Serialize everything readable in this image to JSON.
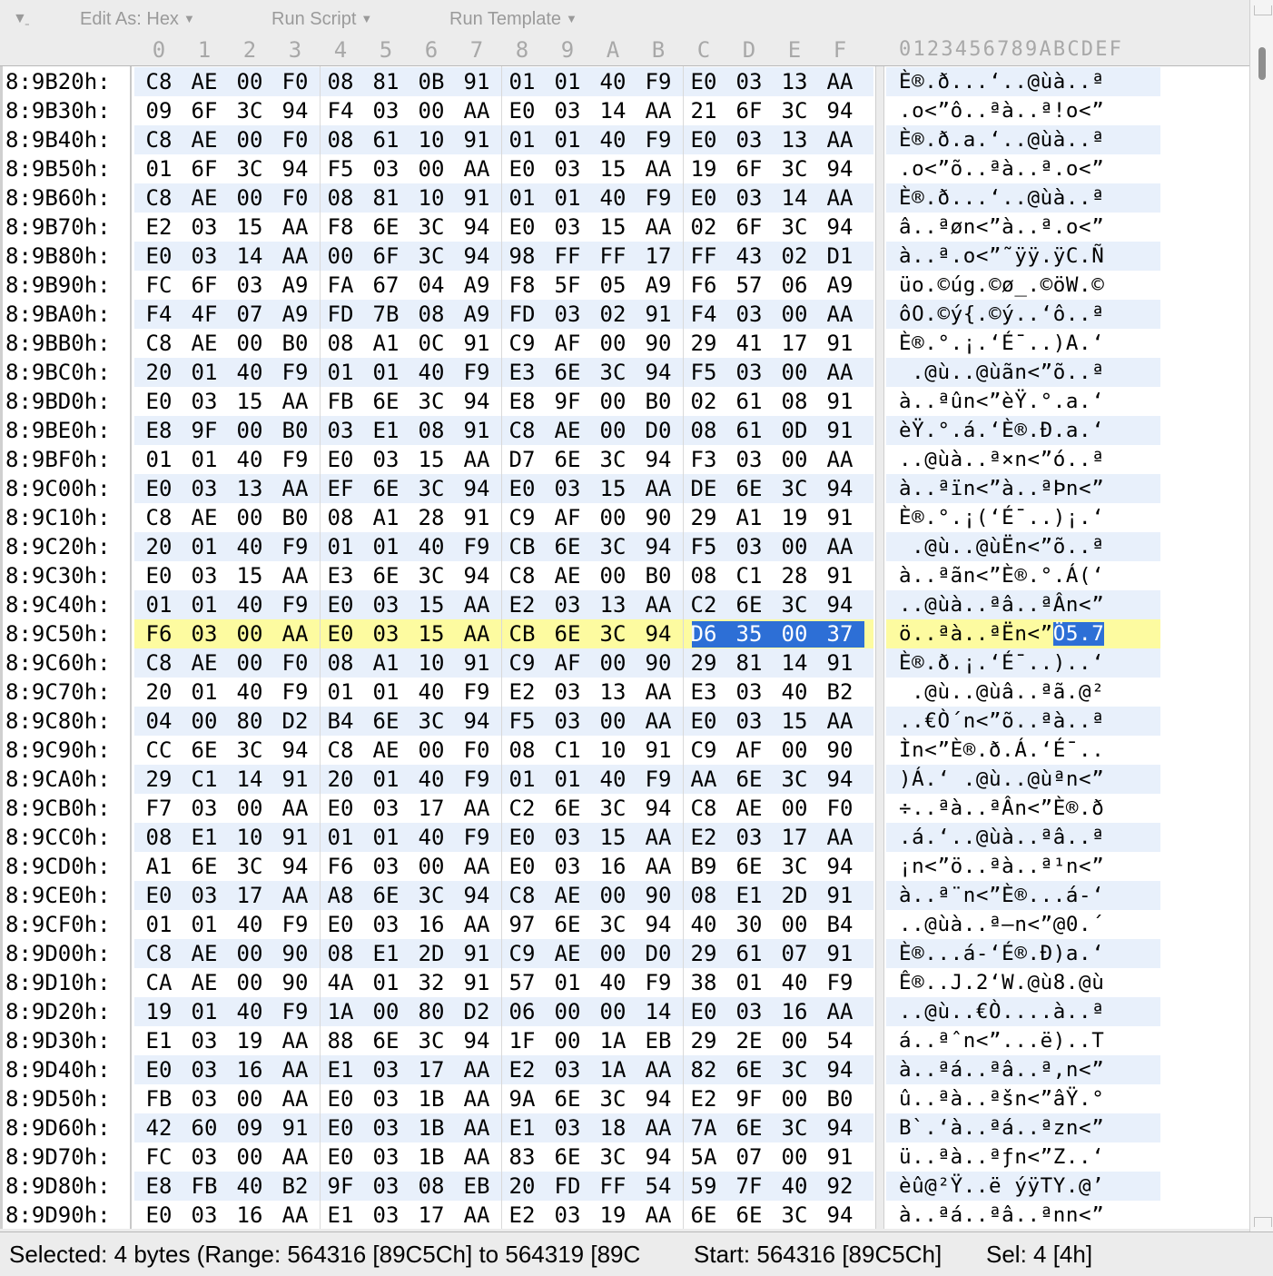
{
  "toolbar": {
    "collapse_icon": "collapse-icon",
    "edit_as": "Edit As: Hex",
    "run_script": "Run Script",
    "run_template": "Run Template",
    "dropdown_icon": "chevron-down-icon"
  },
  "header": {
    "hex_columns": [
      "0",
      "1",
      "2",
      "3",
      "4",
      "5",
      "6",
      "7",
      "8",
      "9",
      "A",
      "B",
      "C",
      "D",
      "E",
      "F"
    ],
    "ascii_header": "0123456789ABCDEF"
  },
  "rows": [
    {
      "addr": "8:9B20h:",
      "bytes": [
        "C8",
        "AE",
        "00",
        "F0",
        "08",
        "81",
        "0B",
        "91",
        "01",
        "01",
        "40",
        "F9",
        "E0",
        "03",
        "13",
        "AA"
      ],
      "ascii": "È®.ð...‘..@ùà..ª"
    },
    {
      "addr": "8:9B30h:",
      "bytes": [
        "09",
        "6F",
        "3C",
        "94",
        "F4",
        "03",
        "00",
        "AA",
        "E0",
        "03",
        "14",
        "AA",
        "21",
        "6F",
        "3C",
        "94"
      ],
      "ascii": ".o<”ô..ªà..ª!o<”"
    },
    {
      "addr": "8:9B40h:",
      "bytes": [
        "C8",
        "AE",
        "00",
        "F0",
        "08",
        "61",
        "10",
        "91",
        "01",
        "01",
        "40",
        "F9",
        "E0",
        "03",
        "13",
        "AA"
      ],
      "ascii": "È®.ð.a.‘..@ùà..ª"
    },
    {
      "addr": "8:9B50h:",
      "bytes": [
        "01",
        "6F",
        "3C",
        "94",
        "F5",
        "03",
        "00",
        "AA",
        "E0",
        "03",
        "15",
        "AA",
        "19",
        "6F",
        "3C",
        "94"
      ],
      "ascii": ".o<”õ..ªà..ª.o<”"
    },
    {
      "addr": "8:9B60h:",
      "bytes": [
        "C8",
        "AE",
        "00",
        "F0",
        "08",
        "81",
        "10",
        "91",
        "01",
        "01",
        "40",
        "F9",
        "E0",
        "03",
        "14",
        "AA"
      ],
      "ascii": "È®.ð...‘..@ùà..ª"
    },
    {
      "addr": "8:9B70h:",
      "bytes": [
        "E2",
        "03",
        "15",
        "AA",
        "F8",
        "6E",
        "3C",
        "94",
        "E0",
        "03",
        "15",
        "AA",
        "02",
        "6F",
        "3C",
        "94"
      ],
      "ascii": "â..ªøn<”à..ª.o<”"
    },
    {
      "addr": "8:9B80h:",
      "bytes": [
        "E0",
        "03",
        "14",
        "AA",
        "00",
        "6F",
        "3C",
        "94",
        "98",
        "FF",
        "FF",
        "17",
        "FF",
        "43",
        "02",
        "D1"
      ],
      "ascii": "à..ª.o<”˜ÿÿ.ÿC.Ñ"
    },
    {
      "addr": "8:9B90h:",
      "bytes": [
        "FC",
        "6F",
        "03",
        "A9",
        "FA",
        "67",
        "04",
        "A9",
        "F8",
        "5F",
        "05",
        "A9",
        "F6",
        "57",
        "06",
        "A9"
      ],
      "ascii": "üo.©úg.©ø_.©öW.©"
    },
    {
      "addr": "8:9BA0h:",
      "bytes": [
        "F4",
        "4F",
        "07",
        "A9",
        "FD",
        "7B",
        "08",
        "A9",
        "FD",
        "03",
        "02",
        "91",
        "F4",
        "03",
        "00",
        "AA"
      ],
      "ascii": "ôO.©ý{.©ý..‘ô..ª"
    },
    {
      "addr": "8:9BB0h:",
      "bytes": [
        "C8",
        "AE",
        "00",
        "B0",
        "08",
        "A1",
        "0C",
        "91",
        "C9",
        "AF",
        "00",
        "90",
        "29",
        "41",
        "17",
        "91"
      ],
      "ascii": "È®.°.¡.‘É¯..)A.‘"
    },
    {
      "addr": "8:9BC0h:",
      "bytes": [
        "20",
        "01",
        "40",
        "F9",
        "01",
        "01",
        "40",
        "F9",
        "E3",
        "6E",
        "3C",
        "94",
        "F5",
        "03",
        "00",
        "AA"
      ],
      "ascii": " .@ù..@ùãn<”õ..ª"
    },
    {
      "addr": "8:9BD0h:",
      "bytes": [
        "E0",
        "03",
        "15",
        "AA",
        "FB",
        "6E",
        "3C",
        "94",
        "E8",
        "9F",
        "00",
        "B0",
        "02",
        "61",
        "08",
        "91"
      ],
      "ascii": "à..ªûn<”èŸ.°.a.‘"
    },
    {
      "addr": "8:9BE0h:",
      "bytes": [
        "E8",
        "9F",
        "00",
        "B0",
        "03",
        "E1",
        "08",
        "91",
        "C8",
        "AE",
        "00",
        "D0",
        "08",
        "61",
        "0D",
        "91"
      ],
      "ascii": "èŸ.°.á.‘È®.Ð.a.‘"
    },
    {
      "addr": "8:9BF0h:",
      "bytes": [
        "01",
        "01",
        "40",
        "F9",
        "E0",
        "03",
        "15",
        "AA",
        "D7",
        "6E",
        "3C",
        "94",
        "F3",
        "03",
        "00",
        "AA"
      ],
      "ascii": "..@ùà..ª×n<”ó..ª"
    },
    {
      "addr": "8:9C00h:",
      "bytes": [
        "E0",
        "03",
        "13",
        "AA",
        "EF",
        "6E",
        "3C",
        "94",
        "E0",
        "03",
        "15",
        "AA",
        "DE",
        "6E",
        "3C",
        "94"
      ],
      "ascii": "à..ªïn<”à..ªÞn<”"
    },
    {
      "addr": "8:9C10h:",
      "bytes": [
        "C8",
        "AE",
        "00",
        "B0",
        "08",
        "A1",
        "28",
        "91",
        "C9",
        "AF",
        "00",
        "90",
        "29",
        "A1",
        "19",
        "91"
      ],
      "ascii": "È®.°.¡(‘É¯..)¡.‘"
    },
    {
      "addr": "8:9C20h:",
      "bytes": [
        "20",
        "01",
        "40",
        "F9",
        "01",
        "01",
        "40",
        "F9",
        "CB",
        "6E",
        "3C",
        "94",
        "F5",
        "03",
        "00",
        "AA"
      ],
      "ascii": " .@ù..@ùËn<”õ..ª"
    },
    {
      "addr": "8:9C30h:",
      "bytes": [
        "E0",
        "03",
        "15",
        "AA",
        "E3",
        "6E",
        "3C",
        "94",
        "C8",
        "AE",
        "00",
        "B0",
        "08",
        "C1",
        "28",
        "91"
      ],
      "ascii": "à..ªãn<”È®.°.Á(‘"
    },
    {
      "addr": "8:9C40h:",
      "bytes": [
        "01",
        "01",
        "40",
        "F9",
        "E0",
        "03",
        "15",
        "AA",
        "E2",
        "03",
        "13",
        "AA",
        "C2",
        "6E",
        "3C",
        "94"
      ],
      "ascii": "..@ùà..ªâ..ªÂn<”"
    },
    {
      "addr": "8:9C50h:",
      "bytes": [
        "F6",
        "03",
        "00",
        "AA",
        "E0",
        "03",
        "15",
        "AA",
        "CB",
        "6E",
        "3C",
        "94",
        "D6",
        "35",
        "00",
        "37"
      ],
      "ascii": "ö..ªà..ªËn<”Ö5.7",
      "selected": true
    },
    {
      "addr": "8:9C60h:",
      "bytes": [
        "C8",
        "AE",
        "00",
        "F0",
        "08",
        "A1",
        "10",
        "91",
        "C9",
        "AF",
        "00",
        "90",
        "29",
        "81",
        "14",
        "91"
      ],
      "ascii": "È®.ð.¡.‘É¯..)..‘"
    },
    {
      "addr": "8:9C70h:",
      "bytes": [
        "20",
        "01",
        "40",
        "F9",
        "01",
        "01",
        "40",
        "F9",
        "E2",
        "03",
        "13",
        "AA",
        "E3",
        "03",
        "40",
        "B2"
      ],
      "ascii": " .@ù..@ùâ..ªã.@²"
    },
    {
      "addr": "8:9C80h:",
      "bytes": [
        "04",
        "00",
        "80",
        "D2",
        "B4",
        "6E",
        "3C",
        "94",
        "F5",
        "03",
        "00",
        "AA",
        "E0",
        "03",
        "15",
        "AA"
      ],
      "ascii": "..€Ò´n<”õ..ªà..ª"
    },
    {
      "addr": "8:9C90h:",
      "bytes": [
        "CC",
        "6E",
        "3C",
        "94",
        "C8",
        "AE",
        "00",
        "F0",
        "08",
        "C1",
        "10",
        "91",
        "C9",
        "AF",
        "00",
        "90"
      ],
      "ascii": "Ìn<”È®.ð.Á.‘É¯.."
    },
    {
      "addr": "8:9CA0h:",
      "bytes": [
        "29",
        "C1",
        "14",
        "91",
        "20",
        "01",
        "40",
        "F9",
        "01",
        "01",
        "40",
        "F9",
        "AA",
        "6E",
        "3C",
        "94"
      ],
      "ascii": ")Á.‘ .@ù..@ùªn<”"
    },
    {
      "addr": "8:9CB0h:",
      "bytes": [
        "F7",
        "03",
        "00",
        "AA",
        "E0",
        "03",
        "17",
        "AA",
        "C2",
        "6E",
        "3C",
        "94",
        "C8",
        "AE",
        "00",
        "F0"
      ],
      "ascii": "÷..ªà..ªÂn<”È®.ð"
    },
    {
      "addr": "8:9CC0h:",
      "bytes": [
        "08",
        "E1",
        "10",
        "91",
        "01",
        "01",
        "40",
        "F9",
        "E0",
        "03",
        "15",
        "AA",
        "E2",
        "03",
        "17",
        "AA"
      ],
      "ascii": ".á.‘..@ùà..ªâ..ª"
    },
    {
      "addr": "8:9CD0h:",
      "bytes": [
        "A1",
        "6E",
        "3C",
        "94",
        "F6",
        "03",
        "00",
        "AA",
        "E0",
        "03",
        "16",
        "AA",
        "B9",
        "6E",
        "3C",
        "94"
      ],
      "ascii": "¡n<”ö..ªà..ª¹n<”"
    },
    {
      "addr": "8:9CE0h:",
      "bytes": [
        "E0",
        "03",
        "17",
        "AA",
        "A8",
        "6E",
        "3C",
        "94",
        "C8",
        "AE",
        "00",
        "90",
        "08",
        "E1",
        "2D",
        "91"
      ],
      "ascii": "à..ª¨n<”È®...á-‘"
    },
    {
      "addr": "8:9CF0h:",
      "bytes": [
        "01",
        "01",
        "40",
        "F9",
        "E0",
        "03",
        "16",
        "AA",
        "97",
        "6E",
        "3C",
        "94",
        "40",
        "30",
        "00",
        "B4"
      ],
      "ascii": "..@ùà..ª—n<”@0.´"
    },
    {
      "addr": "8:9D00h:",
      "bytes": [
        "C8",
        "AE",
        "00",
        "90",
        "08",
        "E1",
        "2D",
        "91",
        "C9",
        "AE",
        "00",
        "D0",
        "29",
        "61",
        "07",
        "91"
      ],
      "ascii": "È®...á-‘É®.Ð)a.‘"
    },
    {
      "addr": "8:9D10h:",
      "bytes": [
        "CA",
        "AE",
        "00",
        "90",
        "4A",
        "01",
        "32",
        "91",
        "57",
        "01",
        "40",
        "F9",
        "38",
        "01",
        "40",
        "F9"
      ],
      "ascii": "Ê®..J.2‘W.@ù8.@ù"
    },
    {
      "addr": "8:9D20h:",
      "bytes": [
        "19",
        "01",
        "40",
        "F9",
        "1A",
        "00",
        "80",
        "D2",
        "06",
        "00",
        "00",
        "14",
        "E0",
        "03",
        "16",
        "AA"
      ],
      "ascii": "..@ù..€Ò....à..ª"
    },
    {
      "addr": "8:9D30h:",
      "bytes": [
        "E1",
        "03",
        "19",
        "AA",
        "88",
        "6E",
        "3C",
        "94",
        "1F",
        "00",
        "1A",
        "EB",
        "29",
        "2E",
        "00",
        "54"
      ],
      "ascii": "á..ªˆn<”...ë)..T"
    },
    {
      "addr": "8:9D40h:",
      "bytes": [
        "E0",
        "03",
        "16",
        "AA",
        "E1",
        "03",
        "17",
        "AA",
        "E2",
        "03",
        "1A",
        "AA",
        "82",
        "6E",
        "3C",
        "94"
      ],
      "ascii": "à..ªá..ªâ..ª‚n<”"
    },
    {
      "addr": "8:9D50h:",
      "bytes": [
        "FB",
        "03",
        "00",
        "AA",
        "E0",
        "03",
        "1B",
        "AA",
        "9A",
        "6E",
        "3C",
        "94",
        "E2",
        "9F",
        "00",
        "B0"
      ],
      "ascii": "û..ªà..ªšn<”âŸ.°"
    },
    {
      "addr": "8:9D60h:",
      "bytes": [
        "42",
        "60",
        "09",
        "91",
        "E0",
        "03",
        "1B",
        "AA",
        "E1",
        "03",
        "18",
        "AA",
        "7A",
        "6E",
        "3C",
        "94"
      ],
      "ascii": "B`.‘à..ªá..ªzn<”"
    },
    {
      "addr": "8:9D70h:",
      "bytes": [
        "FC",
        "03",
        "00",
        "AA",
        "E0",
        "03",
        "1B",
        "AA",
        "83",
        "6E",
        "3C",
        "94",
        "5A",
        "07",
        "00",
        "91"
      ],
      "ascii": "ü..ªà..ªƒn<”Z..‘"
    },
    {
      "addr": "8:9D80h:",
      "bytes": [
        "E8",
        "FB",
        "40",
        "B2",
        "9F",
        "03",
        "08",
        "EB",
        "20",
        "FD",
        "FF",
        "54",
        "59",
        "7F",
        "40",
        "92"
      ],
      "ascii": "èû@²Ÿ..ë ýÿTY.@’"
    },
    {
      "addr": "8:9D90h:",
      "bytes": [
        "E0",
        "03",
        "16",
        "AA",
        "E1",
        "03",
        "17",
        "AA",
        "E2",
        "03",
        "19",
        "AA",
        "6E",
        "6E",
        "3C",
        "94"
      ],
      "ascii": "à..ªá..ªâ..ªnn<”"
    }
  ],
  "selection": {
    "row": 19,
    "start": 12,
    "end": 15
  },
  "status": {
    "selected": "Selected: 4 bytes (Range: 564316 [89C5Ch] to 564319 [89C",
    "start": "Start: 564316 [89C5Ch]",
    "sel": "Sel: 4 [4h]"
  },
  "colors": {
    "selection": "#2d6fd6",
    "row_highlight": "#fdfba0",
    "alt_row": "#e8f0fb"
  }
}
